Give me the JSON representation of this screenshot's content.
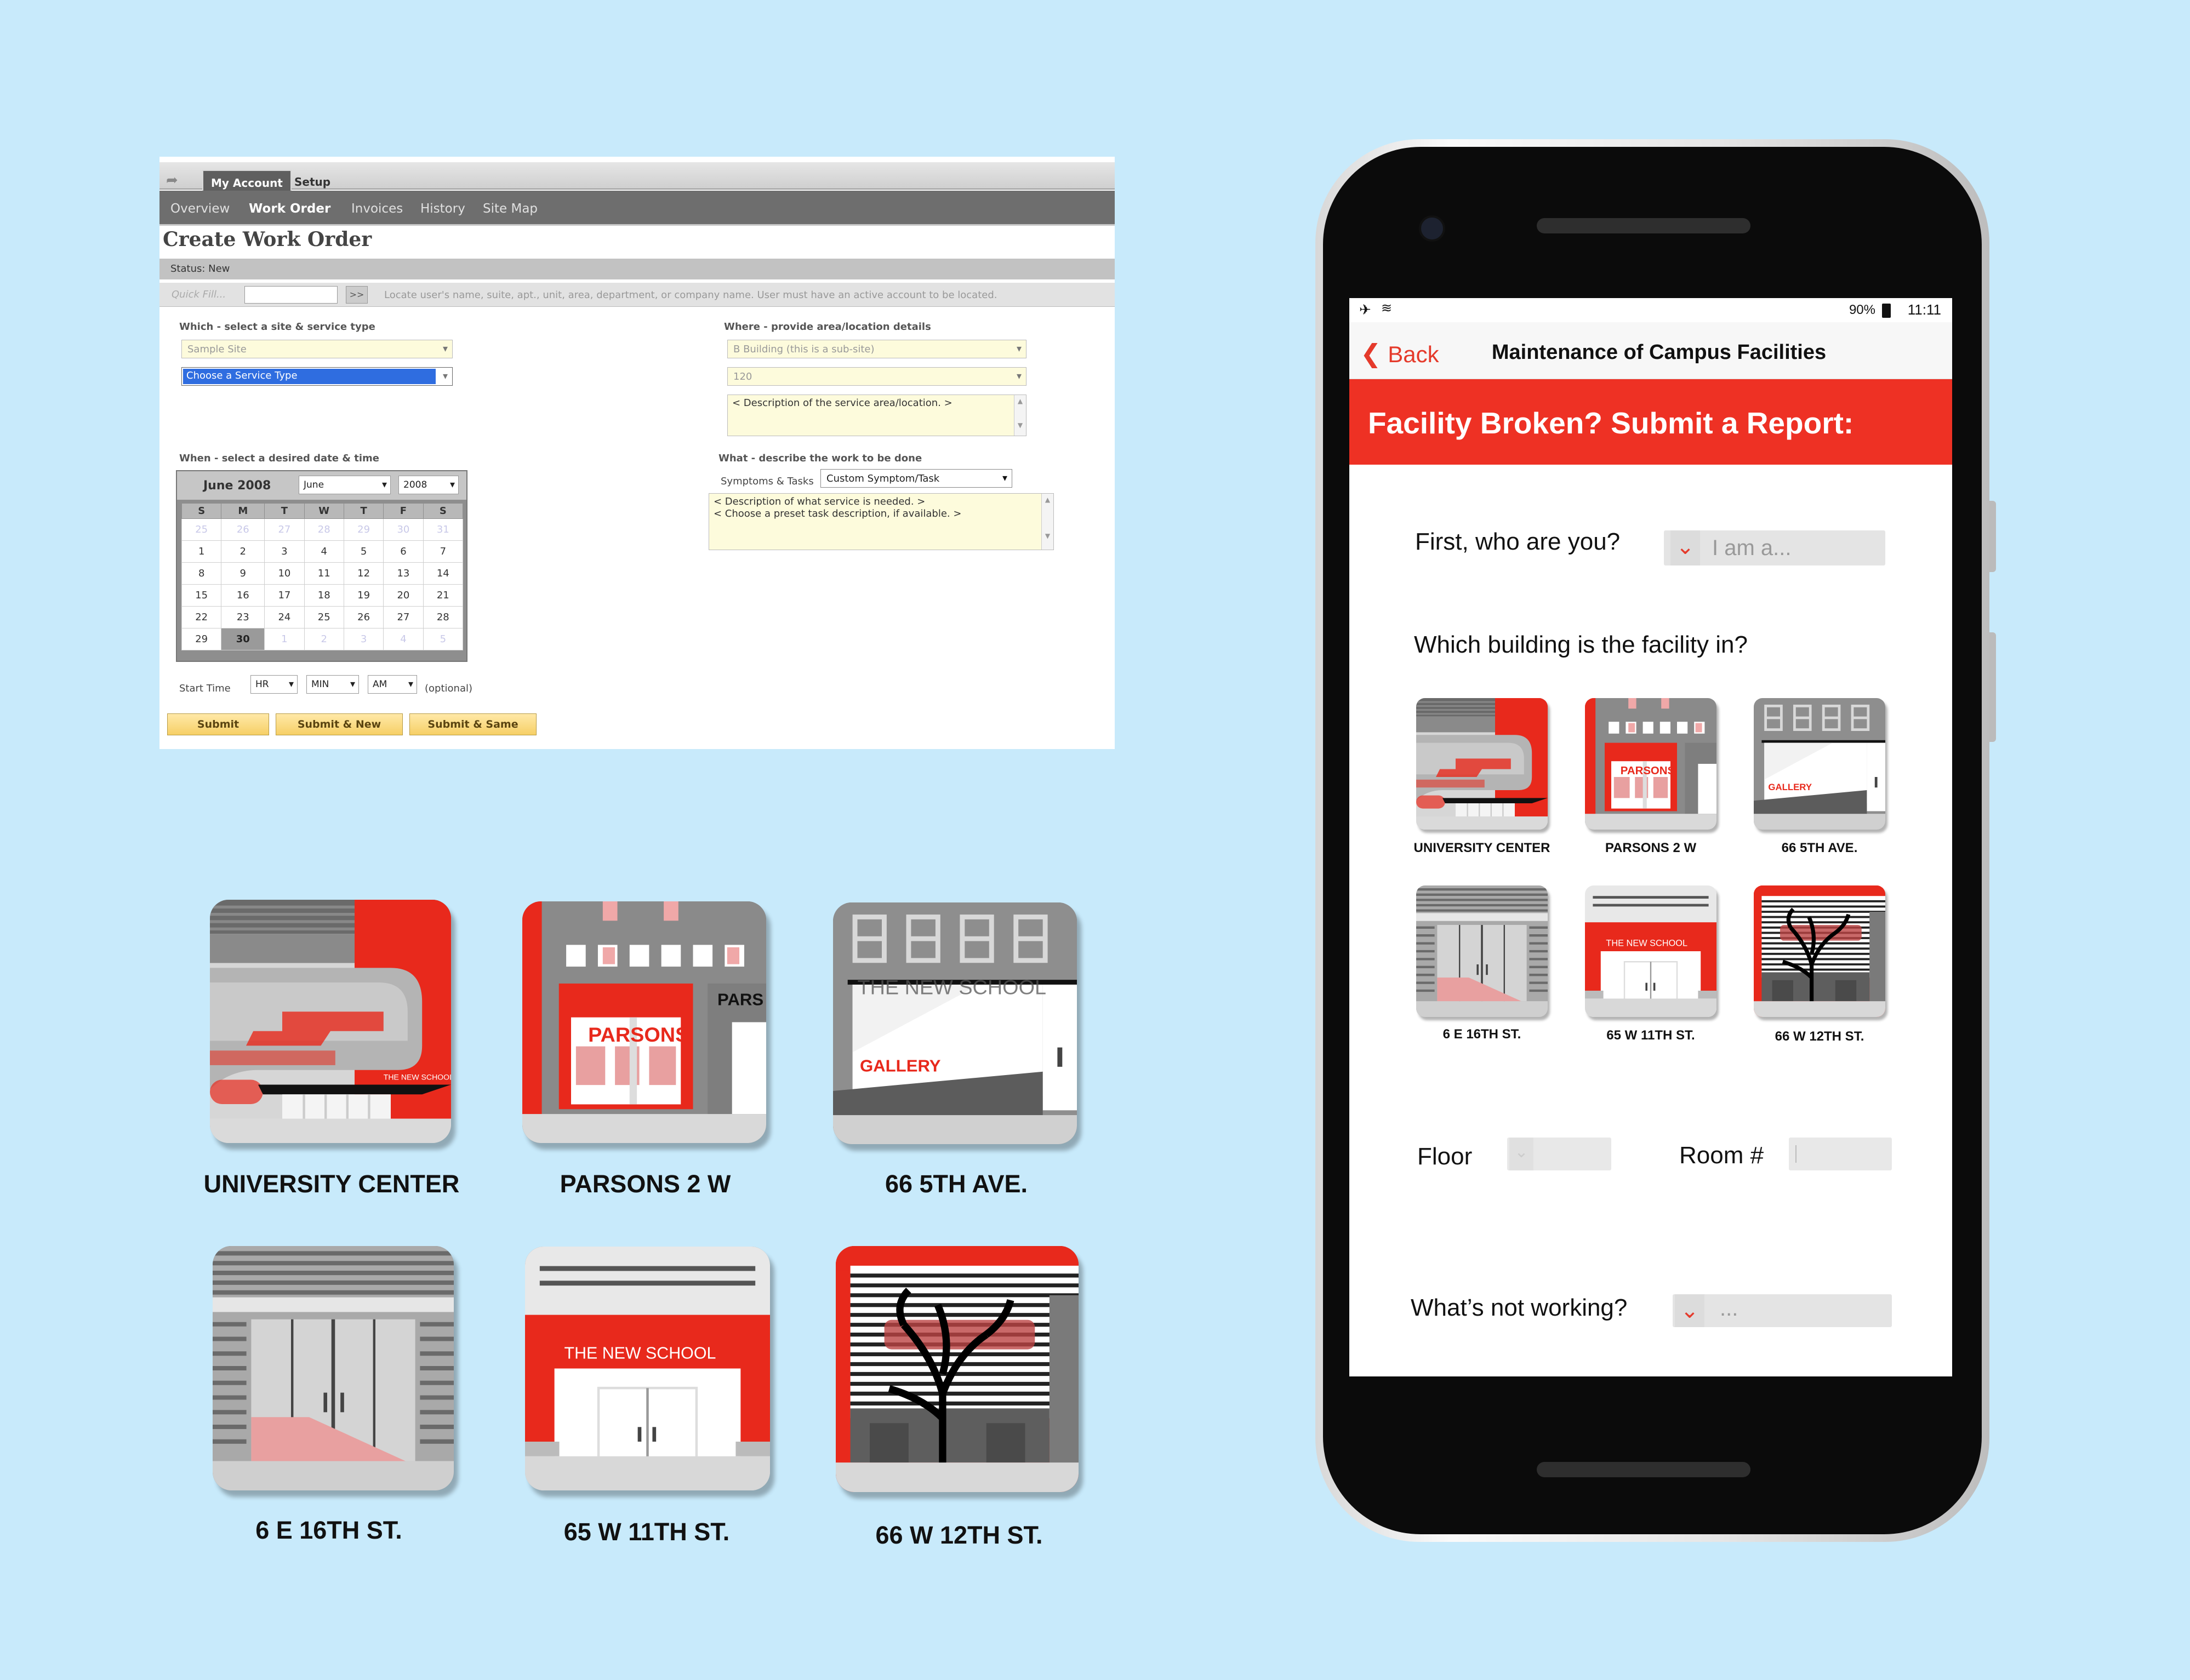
{
  "work_order": {
    "tabs": [
      "My Account",
      "Setup"
    ],
    "subnav": [
      "Overview",
      "Work Order",
      "Invoices",
      "History",
      "Site Map"
    ],
    "title": "Create Work Order",
    "status": "Status: New",
    "quick_fill_placeholder": "Quick Fill...",
    "quick_fill_button": ">>",
    "quick_fill_hint": "Locate user's name, suite, apt., unit, area, department, or company name. User must have an active account to be located.",
    "which": {
      "label": "Which - select a site & service type",
      "site": "Sample Site",
      "service_type": "Choose a Service Type"
    },
    "where": {
      "label": "Where - provide area/location details",
      "building": "B Building (this is a sub-site)",
      "unit": "120",
      "description": "< Description of the service area/location. >"
    },
    "when": {
      "label": "When - select a desired date & time"
    },
    "what": {
      "label": "What - describe the work to be done",
      "symptoms_label": "Symptoms & Tasks",
      "symptom": "Custom Symptom/Task",
      "line1": "< Description of what service is needed. >",
      "line2": "< Choose a preset task description, if available. >"
    },
    "calendar": {
      "title": "June 2008",
      "month": "June",
      "year": "2008",
      "weekdays": [
        "S",
        "M",
        "T",
        "W",
        "T",
        "F",
        "S"
      ],
      "weeks": [
        [
          "25",
          "26",
          "27",
          "28",
          "29",
          "30",
          "31"
        ],
        [
          "1",
          "2",
          "3",
          "4",
          "5",
          "6",
          "7"
        ],
        [
          "8",
          "9",
          "10",
          "11",
          "12",
          "13",
          "14"
        ],
        [
          "15",
          "16",
          "17",
          "18",
          "19",
          "20",
          "21"
        ],
        [
          "22",
          "23",
          "24",
          "25",
          "26",
          "27",
          "28"
        ],
        [
          "29",
          "30",
          "1",
          "2",
          "3",
          "4",
          "5"
        ]
      ],
      "selected": "30"
    },
    "start_time": {
      "label": "Start Time",
      "hr": "HR",
      "min": "MIN",
      "ampm": "AM",
      "optional": "(optional)"
    },
    "buttons": [
      "Submit",
      "Submit & New",
      "Submit & Same"
    ]
  },
  "icons": {
    "labels": [
      "UNIVERSITY CENTER",
      "PARSONS 2 W",
      "66 5TH AVE.",
      "6 E 16TH ST.",
      "65 W 11TH ST.",
      "66 W 12TH ST."
    ],
    "texts": {
      "new_school": "THE NEW SCHOOL",
      "parsons": "PARSONS",
      "pars": "PARS",
      "gallery": "GALLERY",
      "the_new": "THE NEW",
      "school_small": "SCHOOL"
    }
  },
  "phone": {
    "status": {
      "battery": "90%",
      "time": "11:11"
    },
    "back": "Back",
    "title": "Maintenance of Campus Facilities",
    "banner": "Facility Broken? Submit a Report:",
    "q_who": "First, who are you?",
    "who_placeholder": "I am a...",
    "q_building": "Which building is the facility in?",
    "floor_label": "Floor",
    "room_label": "Room #",
    "q_what": "What’s not working?",
    "what_placeholder": "...",
    "buildings": [
      "UNIVERSITY CENTER",
      "PARSONS 2 W",
      "66 5TH AVE.",
      "6 E 16TH ST.",
      "65 W 11TH ST.",
      "66 W 12TH ST."
    ]
  },
  "colors": {
    "background": "#c8eafb",
    "brand_red": "#ee3124",
    "gray": "#7a7a7a",
    "light_gray": "#cfcfcf"
  }
}
